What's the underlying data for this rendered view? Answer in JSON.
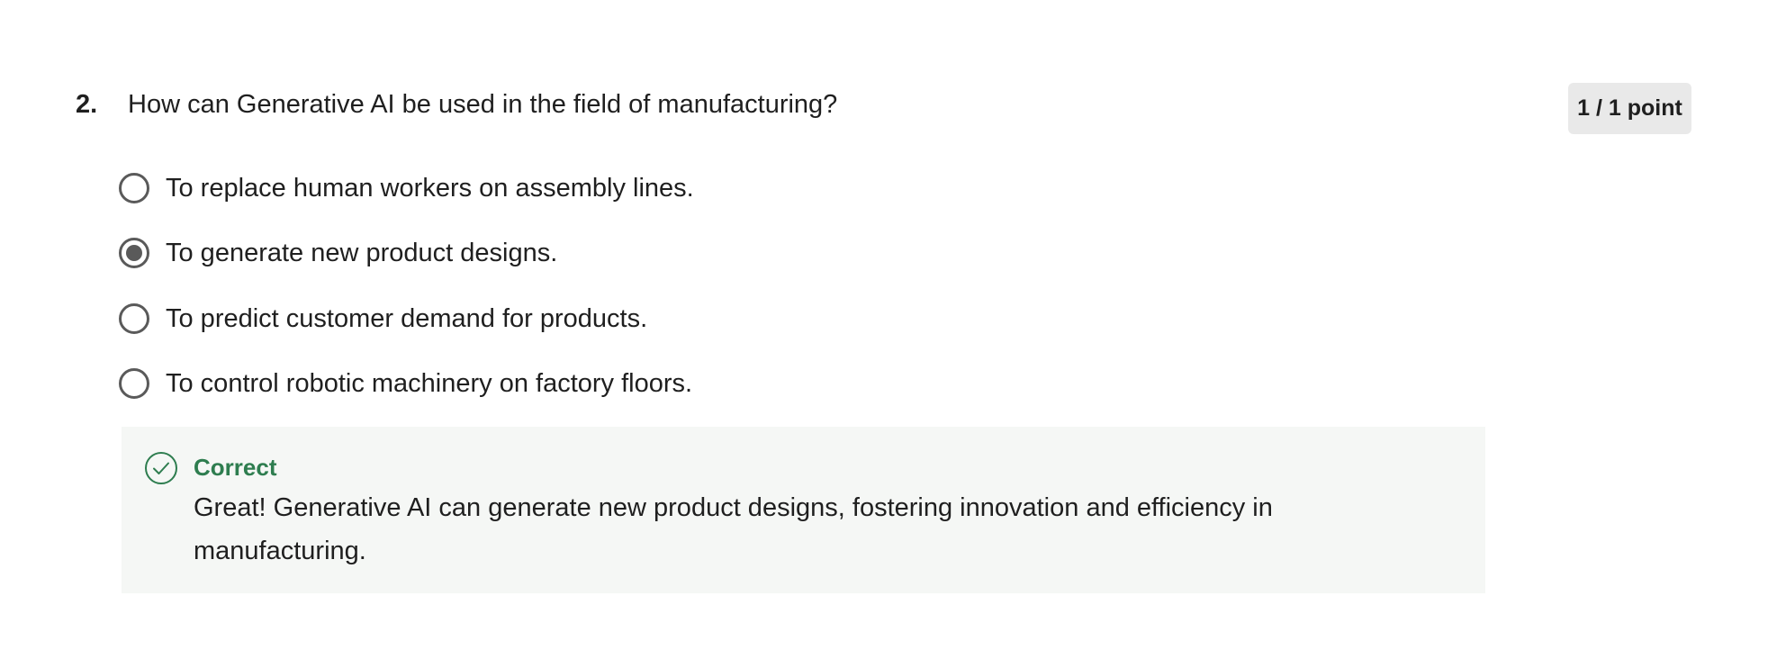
{
  "question": {
    "number": "2.",
    "text": "How can Generative AI be used in the field of manufacturing?",
    "points": "1 / 1 point"
  },
  "options": [
    {
      "label": "To replace human workers on assembly lines.",
      "selected": false
    },
    {
      "label": "To generate new product designs.",
      "selected": true
    },
    {
      "label": "To predict customer demand for products.",
      "selected": false
    },
    {
      "label": "To control robotic machinery on factory floors.",
      "selected": false
    }
  ],
  "feedback": {
    "status": "Correct",
    "message": "Great! Generative AI can generate new product designs, fostering innovation and efficiency in manufacturing.",
    "icon": "check-circle-icon",
    "status_color": "#2e7d4f"
  }
}
